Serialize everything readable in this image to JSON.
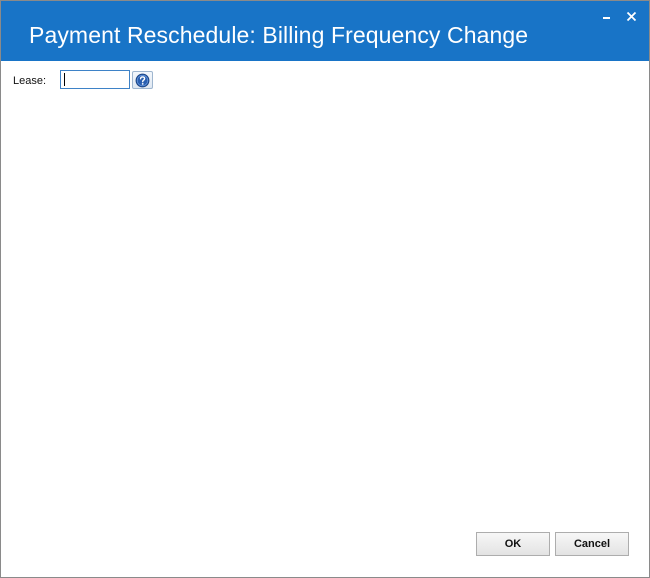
{
  "window": {
    "title": "Payment Reschedule: Billing Frequency Change",
    "minimize_icon": "minimize-icon",
    "close_icon": "close-icon",
    "accent_color": "#1874c7"
  },
  "form": {
    "lease_label": "Lease:",
    "lease_value": "",
    "help_icon": "question-mark-icon"
  },
  "footer": {
    "ok_label": "OK",
    "cancel_label": "Cancel"
  }
}
